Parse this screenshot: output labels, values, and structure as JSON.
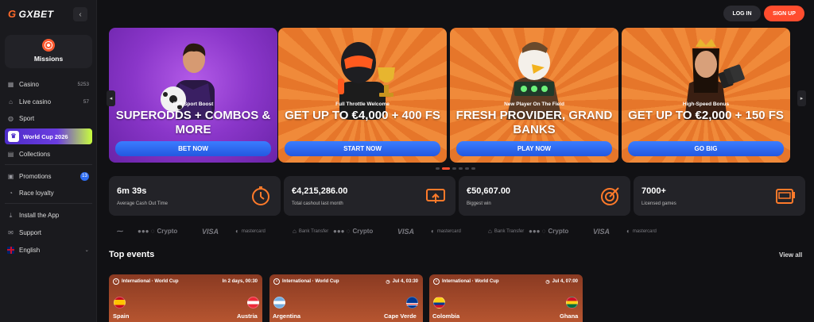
{
  "brand": {
    "logo_text": "GXBET",
    "accent": "#ff4d2e"
  },
  "header": {
    "login": "LOG IN",
    "signup": "SIGN UP"
  },
  "sidebar": {
    "missions": "Missions",
    "items": [
      {
        "label": "Casino",
        "count": "5253",
        "icon": "casino-icon"
      },
      {
        "label": "Live casino",
        "count": "57",
        "icon": "live-casino-icon"
      },
      {
        "label": "Sport",
        "icon": "sport-icon"
      },
      {
        "label": "World Cup 2026",
        "icon": "trophy-icon"
      },
      {
        "label": "Collections",
        "icon": "collections-icon"
      },
      {
        "label": "Promotions",
        "badge": "13",
        "icon": "gift-icon"
      },
      {
        "label": "Race loyalty",
        "icon": "race-icon"
      },
      {
        "label": "Install the App",
        "icon": "download-icon"
      },
      {
        "label": "Support",
        "icon": "support-icon"
      },
      {
        "label": "English",
        "icon": "flag-uk-icon"
      }
    ]
  },
  "banners": [
    {
      "sub": "Full Sport Boost",
      "title": "SUPERODDS + COMBOS & MORE",
      "cta": "BET NOW"
    },
    {
      "sub": "Full Throttle Welcome",
      "title": "GET UP TO €4,000 + 400 FS",
      "cta": "START NOW"
    },
    {
      "sub": "New Player On The Field",
      "title": "FRESH PROVIDER, GRAND BANKS",
      "cta": "PLAY NOW"
    },
    {
      "sub": "High-Speed Bonus",
      "title": "GET UP TO €2,000 + 150 FS",
      "cta": "GO BIG"
    }
  ],
  "stats": [
    {
      "value": "6m 39s",
      "label": "Average Cash Out Time",
      "icon": "stopwatch-icon"
    },
    {
      "value": "€4,215,286.00",
      "label": "Total cashout last month",
      "icon": "cashout-icon"
    },
    {
      "value": "€50,607.00",
      "label": "Biggest win",
      "icon": "target-icon"
    },
    {
      "value": "7000+",
      "label": "Licensed games",
      "icon": "slot-machine-icon"
    }
  ],
  "payments": {
    "crypto": "Crypto",
    "visa": "VISA",
    "mastercard": "mastercard",
    "bank": "Bank Transfer"
  },
  "events": {
    "title": "Top events",
    "view_all": "View all",
    "items": [
      {
        "league": "International · World Cup",
        "time": "In 2 days, 00:30",
        "home": "Spain",
        "away": "Austria"
      },
      {
        "league": "International · World Cup",
        "time": "Jul 4, 03:30",
        "home": "Argentina",
        "away": "Cape Verde"
      },
      {
        "league": "International · World Cup",
        "time": "Jul 4, 07:00",
        "home": "Colombia",
        "away": "Ghana"
      }
    ]
  }
}
